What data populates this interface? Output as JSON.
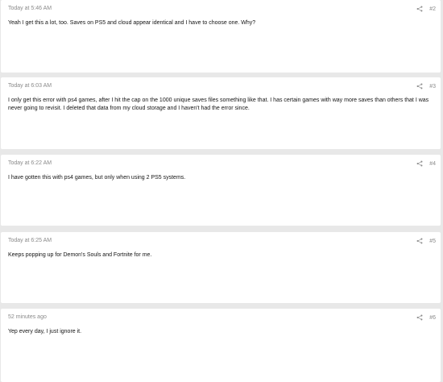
{
  "posts": [
    {
      "date": "Today at 5:46 AM",
      "number": "#2",
      "body": "Yeah I get this a lot, too. Saves on PS5 and cloud appear identical and I have to choose one. Why?"
    },
    {
      "date": "Today at 6:03 AM",
      "number": "#3",
      "body": "I only get this error with ps4 games, after I hit the cap on the 1000 unique saves files something like that. I has certain games with way more saves than others that I was never going to revisit. I deleted that data from my cloud storage and I haven't had the error since."
    },
    {
      "date": "Today at 6:22 AM",
      "number": "#4",
      "body": "I have gotten this with ps4 games, but only when using 2 PS5 systems."
    },
    {
      "date": "Today at 6:25 AM",
      "number": "#5",
      "body": "Keeps popping up for Demon's Souls and Fortnite for me."
    },
    {
      "date": "52 minutes ago",
      "number": "#6",
      "body": "Yep every day, I just ignore it."
    }
  ],
  "icons": {
    "share": "share-icon"
  },
  "colors": {
    "page_background": "#e8e8e8",
    "card_background": "#ffffff",
    "meta_text": "#8a8a8a",
    "body_text": "#141414"
  }
}
